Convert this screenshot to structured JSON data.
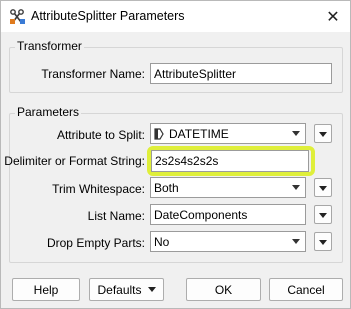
{
  "window": {
    "title": "AttributeSplitter Parameters",
    "close_glyph": "✕"
  },
  "transformer_group": {
    "label": "Transformer",
    "name_label": "Transformer Name:",
    "name_value": "AttributeSplitter"
  },
  "parameters_group": {
    "label": "Parameters",
    "attribute_label": "Attribute to Split:",
    "attribute_value": "DATETIME",
    "attribute_icon": "attribute-tag-icon",
    "delimiter_label": "Delimiter or Format String:",
    "delimiter_value": "2s2s4s2s2s",
    "trim_label": "Trim Whitespace:",
    "trim_value": "Both",
    "list_label": "List Name:",
    "list_value": "DateComponents",
    "drop_label": "Drop Empty Parts:",
    "drop_value": "No"
  },
  "footer": {
    "help_label": "Help",
    "defaults_label": "Defaults",
    "ok_label": "OK",
    "cancel_label": "Cancel"
  },
  "colors": {
    "highlight": "#dfef3a",
    "window_bg": "#f0f0f0"
  }
}
